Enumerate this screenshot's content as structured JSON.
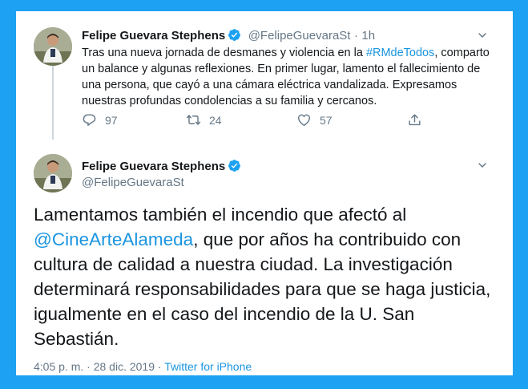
{
  "colors": {
    "frame_border": "#1DA1F2",
    "link": "#1b95e0",
    "muted": "#657786",
    "verified": "#1da1f2"
  },
  "tweet1": {
    "author_name": "Felipe Guevara Stephens",
    "handle": "@FelipeGuevaraSt",
    "separator": "·",
    "time": "1h",
    "text_part1": "Tras una nueva jornada de desmanes y violencia en la ",
    "hashtag": "#RMdeTodos",
    "text_part2": ", comparto un balance y algunas reflexiones.  En primer lugar, lamento el fallecimiento de una persona, que cayó a una cámara eléctrica vandalizada. Expresamos nuestras profundas condolencias a su familia y cercanos.",
    "reply_count": "97",
    "retweet_count": "24",
    "like_count": "57"
  },
  "tweet2": {
    "author_name": "Felipe Guevara Stephens",
    "handle": "@FelipeGuevaraSt",
    "text_part1": "Lamentamos también el incendio que afectó al ",
    "mention": "@CineArteAlameda",
    "text_part2": ", que por años ha contribuido con cultura de calidad a nuestra ciudad. La investigación determinará responsabilidades para que se haga justicia, igualmente en el caso del incendio de la U. San Sebastián.",
    "time": "4:05 p. m.",
    "separator": "·",
    "date": "28 dic. 2019",
    "source": "Twitter for iPhone"
  },
  "icons": {
    "avatar": "avatar-photo",
    "verified": "verified-badge-icon",
    "caret": "chevron-down-icon",
    "reply": "reply-icon",
    "retweet": "retweet-icon",
    "like": "heart-icon",
    "share": "share-icon"
  }
}
